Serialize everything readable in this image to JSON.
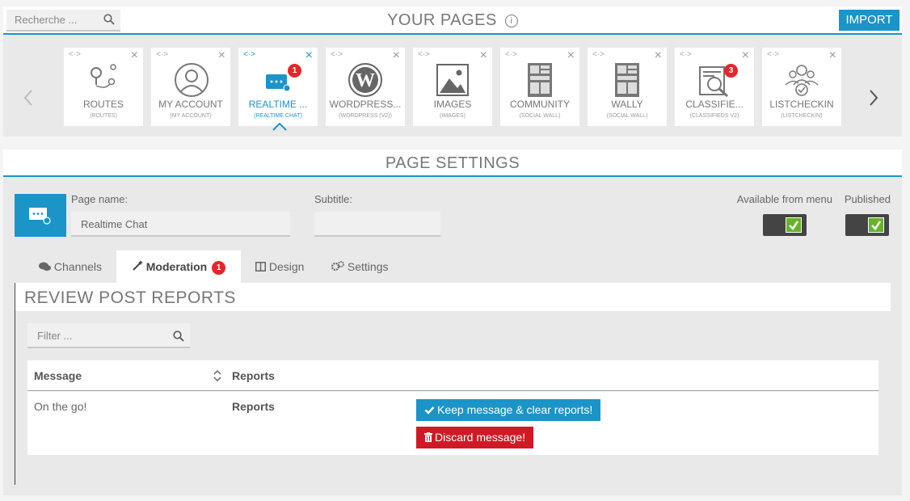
{
  "search": {
    "placeholder": "Recherche ..."
  },
  "header": {
    "title": "YOUR PAGES",
    "info_glyph": "i",
    "import_label": "IMPORT"
  },
  "pages": [
    {
      "label": "ROUTES",
      "sub": "(ROUTES)",
      "icon": "routes-icon"
    },
    {
      "label": "MY ACCOUNT",
      "sub": "(MY ACCOUNT)",
      "icon": "account-icon"
    },
    {
      "label": "REALTIME ...",
      "sub": "(REALTIME CHAT)",
      "icon": "chat-icon",
      "badge": "1"
    },
    {
      "label": "WORDPRESS...",
      "sub": "(WORDPRESS (V2))",
      "icon": "wordpress-icon"
    },
    {
      "label": "IMAGES",
      "sub": "(IMAGES)",
      "icon": "image-icon"
    },
    {
      "label": "COMMUNITY",
      "sub": "(SOCIAL WALL)",
      "icon": "wall-icon"
    },
    {
      "label": "WALLY",
      "sub": "(SOCIAL WALL)",
      "icon": "wall-icon"
    },
    {
      "label": "CLASSIFIE...",
      "sub": "(CLASSIFIEDS V2)",
      "icon": "classifieds-icon",
      "badge": "3"
    },
    {
      "label": "LISTCHECKIN",
      "sub": "(LISTCHECKIN)",
      "icon": "checkin-icon"
    }
  ],
  "settings": {
    "title": "PAGE SETTINGS",
    "page_name_label": "Page name:",
    "page_name_value": "Realtime Chat",
    "subtitle_label": "Subtitle:",
    "subtitle_value": "",
    "available_label": "Available from menu",
    "published_label": "Published"
  },
  "tabs": {
    "channels": "Channels",
    "moderation": "Moderation",
    "moderation_badge": "1",
    "design": "Design",
    "settings": "Settings"
  },
  "review": {
    "title": "REVIEW POST REPORTS",
    "filter_placeholder": "Filter ...",
    "col_message": "Message",
    "col_reports": "Reports",
    "rows": [
      {
        "message": "On the go!",
        "reports": "Reports"
      }
    ],
    "keep_label": "Keep message & clear reports!",
    "discard_label": "Discard message!"
  },
  "colors": {
    "accent": "#1b94c8",
    "danger": "#cf1a25",
    "badge": "#e4262c",
    "check": "#66b22b"
  }
}
